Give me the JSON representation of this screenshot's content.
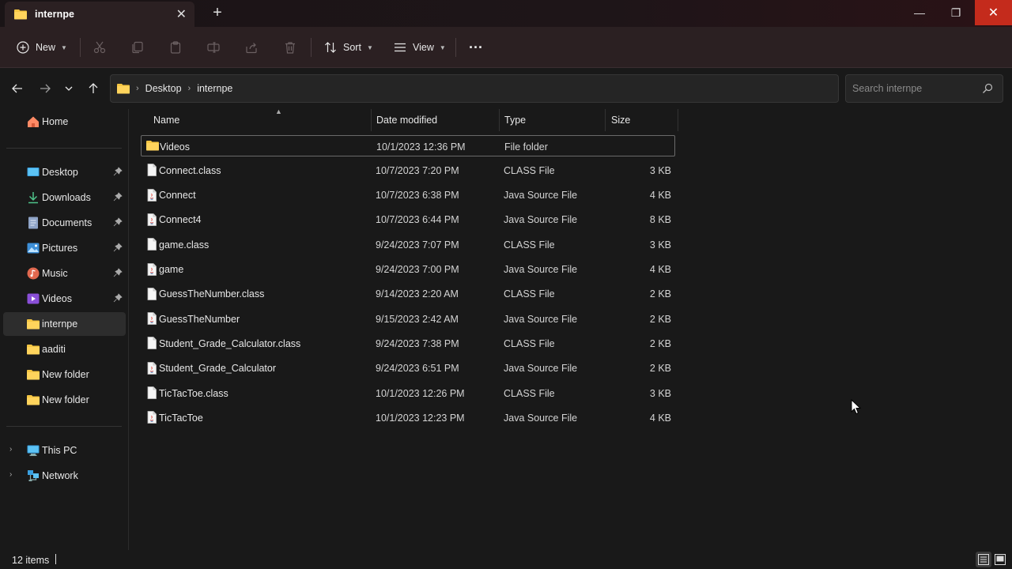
{
  "window": {
    "tab_title": "internpe",
    "new_tab": "+",
    "minimize": "—",
    "maximize": "❐",
    "close": "✕"
  },
  "toolbar": {
    "new_label": "New",
    "sort_label": "Sort",
    "view_label": "View",
    "more_label": "···"
  },
  "address": {
    "crumbs": [
      "Desktop",
      "internpe"
    ],
    "search_placeholder": "Search internpe"
  },
  "sidebar": {
    "home": "Home",
    "pinned": [
      {
        "label": "Desktop",
        "icon": "desktop-icon"
      },
      {
        "label": "Downloads",
        "icon": "download-icon"
      },
      {
        "label": "Documents",
        "icon": "document-icon"
      },
      {
        "label": "Pictures",
        "icon": "pictures-icon"
      },
      {
        "label": "Music",
        "icon": "music-icon"
      },
      {
        "label": "Videos",
        "icon": "videos-icon"
      }
    ],
    "folders": [
      "internpe",
      "aaditi",
      "New folder",
      "New folder"
    ],
    "this_pc": "This PC",
    "network": "Network"
  },
  "columns": {
    "name": "Name",
    "date": "Date modified",
    "type": "Type",
    "size": "Size"
  },
  "files": [
    {
      "name": "Videos",
      "date": "10/1/2023 12:36 PM",
      "type": "File folder",
      "size": "",
      "icon": "folder-icon"
    },
    {
      "name": "Connect.class",
      "date": "10/7/2023 7:20 PM",
      "type": "CLASS File",
      "size": "3 KB",
      "icon": "file-icon"
    },
    {
      "name": "Connect",
      "date": "10/7/2023 6:38 PM",
      "type": "Java Source File",
      "size": "4 KB",
      "icon": "java-file-icon"
    },
    {
      "name": "Connect4",
      "date": "10/7/2023 6:44 PM",
      "type": "Java Source File",
      "size": "8 KB",
      "icon": "java-file-icon"
    },
    {
      "name": "game.class",
      "date": "9/24/2023 7:07 PM",
      "type": "CLASS File",
      "size": "3 KB",
      "icon": "file-icon"
    },
    {
      "name": "game",
      "date": "9/24/2023 7:00 PM",
      "type": "Java Source File",
      "size": "4 KB",
      "icon": "java-file-icon"
    },
    {
      "name": "GuessTheNumber.class",
      "date": "9/14/2023 2:20 AM",
      "type": "CLASS File",
      "size": "2 KB",
      "icon": "file-icon"
    },
    {
      "name": "GuessTheNumber",
      "date": "9/15/2023 2:42 AM",
      "type": "Java Source File",
      "size": "2 KB",
      "icon": "java-file-icon"
    },
    {
      "name": "Student_Grade_Calculator.class",
      "date": "9/24/2023 7:38 PM",
      "type": "CLASS File",
      "size": "2 KB",
      "icon": "file-icon"
    },
    {
      "name": "Student_Grade_Calculator",
      "date": "9/24/2023 6:51 PM",
      "type": "Java Source File",
      "size": "2 KB",
      "icon": "java-file-icon"
    },
    {
      "name": "TicTacToe.class",
      "date": "10/1/2023 12:26 PM",
      "type": "CLASS File",
      "size": "3 KB",
      "icon": "file-icon"
    },
    {
      "name": "TicTacToe",
      "date": "10/1/2023 12:23 PM",
      "type": "Java Source File",
      "size": "4 KB",
      "icon": "java-file-icon"
    }
  ],
  "status": {
    "item_count": "12 items"
  },
  "colors": {
    "folder": "#f4c542",
    "close_button": "#c42b1c",
    "background": "#191919",
    "toolbar": "#2b2022"
  }
}
